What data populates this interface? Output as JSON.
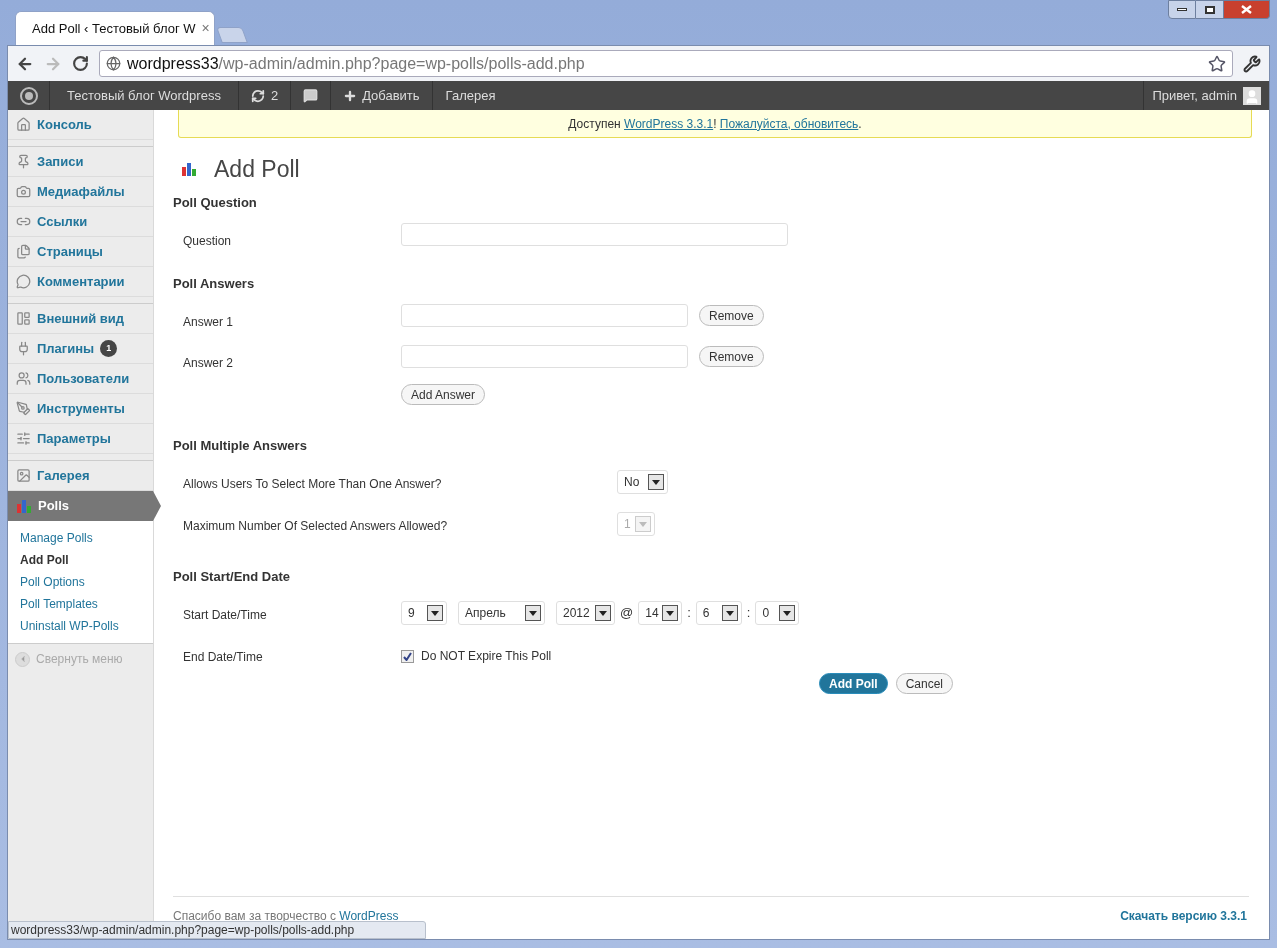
{
  "browser": {
    "tab_title": "Add Poll ‹ Тестовый блог W",
    "tab_close": "×",
    "url_host": "wordpress33",
    "url_path": "/wp-admin/admin.php?page=wp-polls/polls-add.php"
  },
  "admin_bar": {
    "site": "Тестовый блог Wordpress",
    "updates": "2",
    "add_new": "Добавить",
    "gallery": "Галерея",
    "greeting": "Привет, admin"
  },
  "sidebar": {
    "groups": [
      {
        "items": [
          {
            "label": "Консоль",
            "selected": false
          }
        ]
      },
      {
        "items": [
          {
            "label": "Записи",
            "selected": false
          },
          {
            "label": "Медиафайлы",
            "selected": false
          },
          {
            "label": "Ссылки",
            "selected": false
          },
          {
            "label": "Страницы",
            "selected": false
          },
          {
            "label": "Комментарии",
            "selected": false
          }
        ]
      },
      {
        "items": [
          {
            "label": "Внешний вид",
            "selected": false
          },
          {
            "label": "Плагины",
            "selected": false,
            "badge": "1"
          },
          {
            "label": "Пользователи",
            "selected": false
          },
          {
            "label": "Инструменты",
            "selected": false
          },
          {
            "label": "Параметры",
            "selected": false
          }
        ]
      },
      {
        "items": [
          {
            "label": "Галерея",
            "selected": false
          },
          {
            "label": "Polls",
            "selected": true
          }
        ]
      }
    ],
    "submenu": [
      {
        "label": "Manage Polls",
        "selected": false
      },
      {
        "label": "Add Poll",
        "selected": true
      },
      {
        "label": "Poll Options",
        "selected": false
      },
      {
        "label": "Poll Templates",
        "selected": false
      },
      {
        "label": "Uninstall WP-Polls",
        "selected": false
      }
    ],
    "collapse": "Свернуть меню"
  },
  "notice": [
    {
      "kind": "text",
      "text": "Доступен "
    },
    {
      "kind": "link",
      "text": "WordPress 3.3.1"
    },
    {
      "kind": "text",
      "text": "! "
    },
    {
      "kind": "link",
      "text": "Пожалуйста, обновитесь"
    },
    {
      "kind": "text",
      "text": "."
    }
  ],
  "page_title": "Add Poll",
  "sections": [
    {
      "title": "Poll Question",
      "rows": [
        {
          "kind": "text",
          "label": "Question"
        }
      ]
    },
    {
      "title": "Poll Answers",
      "rows": [
        {
          "kind": "answer",
          "label": "Answer 1",
          "button": "Remove"
        },
        {
          "kind": "answer",
          "label": "Answer 2",
          "button": "Remove"
        },
        {
          "kind": "button",
          "button": "Add Answer"
        }
      ]
    },
    {
      "title": "Poll Multiple Answers",
      "rows": [
        {
          "kind": "select",
          "label": "Allows Users To Select More Than One Answer?",
          "value": "No",
          "disabled": false
        },
        {
          "kind": "select",
          "label": "Maximum Number Of Selected Answers Allowed?",
          "value": "1",
          "disabled": true
        }
      ]
    },
    {
      "title": "Poll Start/End Date",
      "rows": [
        {
          "kind": "datetime",
          "label": "Start Date/Time",
          "parts": [
            {
              "kind": "select",
              "value": "9"
            },
            {
              "kind": "select",
              "value": "Апрель"
            },
            {
              "kind": "select",
              "value": "2012"
            },
            {
              "kind": "sep",
              "text": "@"
            },
            {
              "kind": "select",
              "value": "14"
            },
            {
              "kind": "sep",
              "text": ":"
            },
            {
              "kind": "select",
              "value": "6"
            },
            {
              "kind": "sep",
              "text": ":"
            },
            {
              "kind": "select",
              "value": "0"
            }
          ]
        },
        {
          "kind": "checkbox",
          "label": "End Date/Time",
          "text": "Do NOT Expire This Poll",
          "checked": true
        }
      ]
    }
  ],
  "actions": [
    {
      "kind": "primary",
      "label": "Add Poll"
    },
    {
      "kind": "secondary",
      "label": "Cancel"
    }
  ],
  "footer": {
    "thanks": "Спасибо вам за творчество с ",
    "thanks_link": "WordPress",
    "version": "Скачать версию 3.3.1"
  },
  "status_bubble": "wordpress33/wp-admin/admin.php?page=wp-polls/polls-add.php"
}
